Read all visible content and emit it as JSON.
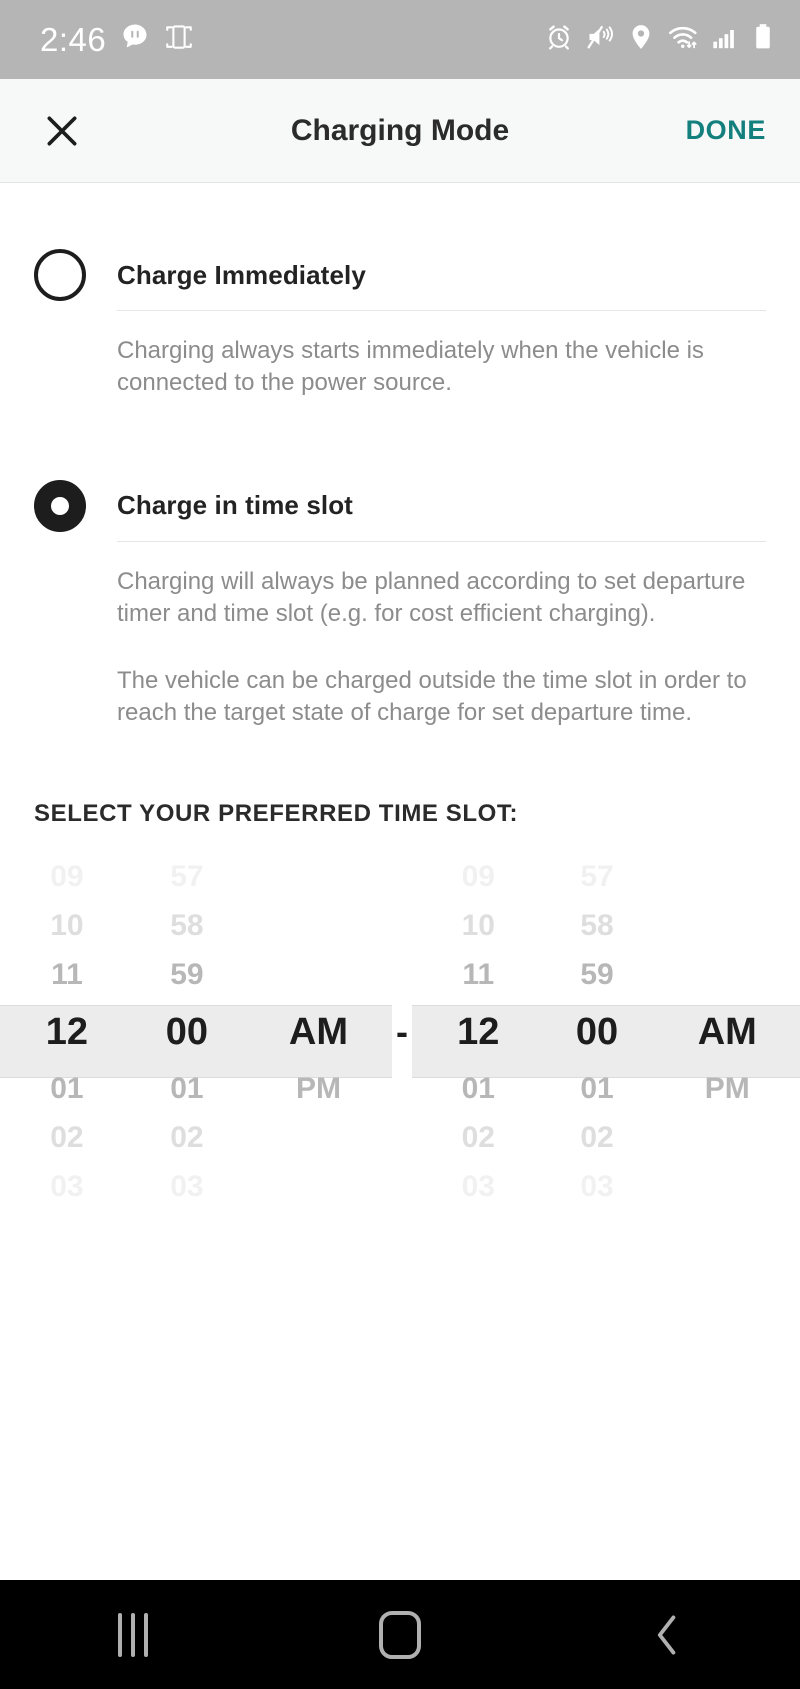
{
  "status_bar": {
    "time": "2:46",
    "left_icons": [
      "chat-bubble-icon",
      "screen-mirror-icon"
    ],
    "right_icons": [
      "alarm-icon",
      "vibrate-mute-icon",
      "location-pin-icon",
      "wifi-icon",
      "signal-bars-icon",
      "battery-icon"
    ],
    "background_color": "#b5b5b5"
  },
  "app_bar": {
    "close_label": "✕",
    "title": "Charging Mode",
    "done_label": "DONE",
    "done_color": "#14807e"
  },
  "options": [
    {
      "label": "Charge Immediately",
      "selected": false,
      "paragraphs": [
        "Charging always starts immediately when the vehicle is connected to the power source."
      ]
    },
    {
      "label": "Charge in time slot",
      "selected": true,
      "paragraphs": [
        "Charging will always be planned according to set departure timer and time slot (e.g. for cost efficient charging).",
        "The vehicle can be charged outside the time slot in order to reach the target state of charge for set departure time."
      ]
    }
  ],
  "time_slot": {
    "heading": "SELECT YOUR PREFERRED TIME SLOT:",
    "separator": "-",
    "start": {
      "hours": [
        "09",
        "10",
        "11",
        "12",
        "01",
        "02",
        "03"
      ],
      "minutes": [
        "57",
        "58",
        "59",
        "00",
        "01",
        "02",
        "03"
      ],
      "meridiem": [
        "",
        "",
        "",
        "AM",
        "PM",
        "",
        ""
      ],
      "selected_hour": "12",
      "selected_minute": "00",
      "selected_meridiem": "AM"
    },
    "end": {
      "hours": [
        "09",
        "10",
        "11",
        "12",
        "01",
        "02",
        "03"
      ],
      "minutes": [
        "57",
        "58",
        "59",
        "00",
        "01",
        "02",
        "03"
      ],
      "meridiem": [
        "",
        "",
        "",
        "AM",
        "PM",
        "",
        ""
      ],
      "selected_hour": "12",
      "selected_minute": "00",
      "selected_meridiem": "AM"
    },
    "highlight_color": "#ececec"
  },
  "nav_bar": {
    "recents_label": "recents-icon",
    "home_label": "home-icon",
    "back_label": "‹"
  }
}
